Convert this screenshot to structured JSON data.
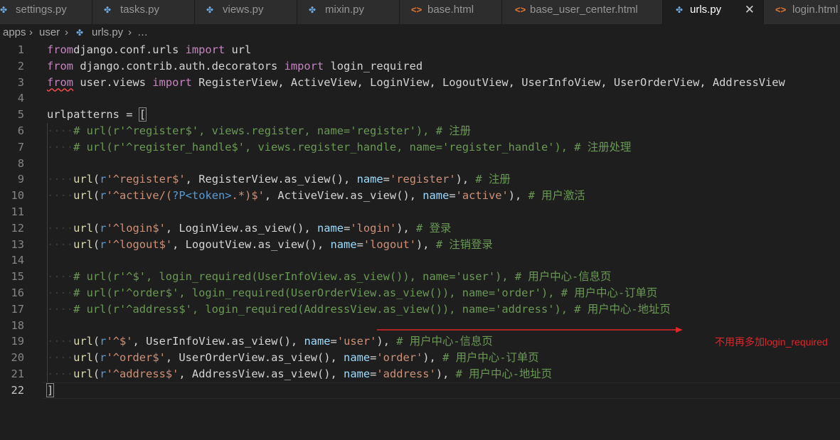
{
  "tabs": [
    {
      "label": "settings.py",
      "icon": "python-icon",
      "active": false
    },
    {
      "label": "tasks.py",
      "icon": "python-icon",
      "active": false
    },
    {
      "label": "views.py",
      "icon": "python-icon",
      "active": false
    },
    {
      "label": "mixin.py",
      "icon": "python-icon",
      "active": false
    },
    {
      "label": "base.html",
      "icon": "html-icon",
      "active": false
    },
    {
      "label": "base_user_center.html",
      "icon": "html-icon",
      "active": false
    },
    {
      "label": "urls.py",
      "icon": "python-icon",
      "active": true,
      "close": "✕"
    },
    {
      "label": "login.html",
      "icon": "html-icon",
      "active": false
    }
  ],
  "breadcrumb": {
    "part1": "apps",
    "part2": "user",
    "file": "urls.py",
    "more": "…",
    "separator": "›"
  },
  "editor": {
    "current_line": 22,
    "lines": [
      {
        "n": "1",
        "t": [
          [
            "kw",
            "from"
          ],
          [
            "",
            "django.conf.urls "
          ],
          [
            "kw",
            "import"
          ],
          [
            "",
            " url"
          ]
        ]
      },
      {
        "n": "2",
        "t": [
          [
            "kw",
            "from"
          ],
          [
            "",
            " django.contrib.auth.decorators "
          ],
          [
            "kw",
            "import"
          ],
          [
            "",
            " login_required"
          ]
        ]
      },
      {
        "n": "3",
        "t": [
          [
            "kw wavy",
            "from"
          ],
          [
            "",
            " user.views "
          ],
          [
            "kw",
            "import"
          ],
          [
            "",
            " RegisterView, ActiveView, LoginView, LogoutView, UserInfoView, UserOrderView, AddressView"
          ]
        ]
      },
      {
        "n": "4",
        "t": []
      },
      {
        "n": "5",
        "t": [
          [
            "",
            "urlpatterns = "
          ],
          [
            "brk",
            "["
          ]
        ]
      },
      {
        "n": "6",
        "t": [
          [
            "ws",
            "····"
          ],
          [
            "cm",
            "# url(r'^register$', views.register, name='register'), # 注册"
          ]
        ]
      },
      {
        "n": "7",
        "t": [
          [
            "ws",
            "····"
          ],
          [
            "cm",
            "# url(r'^register_handle$', views.register_handle, name='register_handle'), # 注册处理"
          ]
        ]
      },
      {
        "n": "8",
        "t": []
      },
      {
        "n": "9",
        "t": [
          [
            "ws",
            "····"
          ],
          [
            "fn",
            "url"
          ],
          [
            "",
            "("
          ],
          [
            "rx",
            "r"
          ],
          [
            "str",
            "'^register$'"
          ],
          [
            "",
            ", RegisterView.as_view(), "
          ],
          [
            "prm",
            "name"
          ],
          [
            "",
            "="
          ],
          [
            "str",
            "'register'"
          ],
          [
            "",
            "), "
          ],
          [
            "cm",
            "# 注册"
          ]
        ]
      },
      {
        "n": "10",
        "t": [
          [
            "ws",
            "····"
          ],
          [
            "fn",
            "url"
          ],
          [
            "",
            "("
          ],
          [
            "rx",
            "r"
          ],
          [
            "str",
            "'^active/("
          ],
          [
            "rx",
            "?P<token>"
          ],
          [
            "str",
            ".*)$'"
          ],
          [
            "",
            ", ActiveView.as_view(), "
          ],
          [
            "prm",
            "name"
          ],
          [
            "",
            "="
          ],
          [
            "str",
            "'active'"
          ],
          [
            "",
            "), "
          ],
          [
            "cm",
            "# 用户激活"
          ]
        ]
      },
      {
        "n": "11",
        "t": []
      },
      {
        "n": "12",
        "t": [
          [
            "ws",
            "····"
          ],
          [
            "fn",
            "url"
          ],
          [
            "",
            "("
          ],
          [
            "rx",
            "r"
          ],
          [
            "str",
            "'^login$'"
          ],
          [
            "",
            ", LoginView.as_view(), "
          ],
          [
            "prm",
            "name"
          ],
          [
            "",
            "="
          ],
          [
            "str",
            "'login'"
          ],
          [
            "",
            "), "
          ],
          [
            "cm",
            "# 登录"
          ]
        ]
      },
      {
        "n": "13",
        "t": [
          [
            "ws",
            "····"
          ],
          [
            "fn",
            "url"
          ],
          [
            "",
            "("
          ],
          [
            "rx",
            "r"
          ],
          [
            "str",
            "'^logout$'"
          ],
          [
            "",
            ", LogoutView.as_view(), "
          ],
          [
            "prm",
            "name"
          ],
          [
            "",
            "="
          ],
          [
            "str",
            "'logout'"
          ],
          [
            "",
            "), "
          ],
          [
            "cm",
            "# 注销登录"
          ]
        ]
      },
      {
        "n": "14",
        "t": []
      },
      {
        "n": "15",
        "t": [
          [
            "ws",
            "····"
          ],
          [
            "cm",
            "# url(r'^$', login_required(UserInfoView.as_view()), name='user'), # 用户中心-信息页"
          ]
        ]
      },
      {
        "n": "16",
        "t": [
          [
            "ws",
            "····"
          ],
          [
            "cm",
            "# url(r'^order$', login_required(UserOrderView.as_view()), name='order'), # 用户中心-订单页"
          ]
        ]
      },
      {
        "n": "17",
        "t": [
          [
            "ws",
            "····"
          ],
          [
            "cm",
            "# url(r'^address$', login_required(AddressView.as_view()), name='address'), # 用户中心-地址页"
          ]
        ]
      },
      {
        "n": "18",
        "t": []
      },
      {
        "n": "19",
        "t": [
          [
            "ws",
            "····"
          ],
          [
            "fn",
            "url"
          ],
          [
            "",
            "("
          ],
          [
            "rx",
            "r"
          ],
          [
            "str",
            "'^$'"
          ],
          [
            "",
            ", UserInfoView.as_view(), "
          ],
          [
            "prm",
            "name"
          ],
          [
            "",
            "="
          ],
          [
            "str",
            "'user'"
          ],
          [
            "",
            "), "
          ],
          [
            "cm",
            "# 用户中心-信息页"
          ]
        ]
      },
      {
        "n": "20",
        "t": [
          [
            "ws",
            "····"
          ],
          [
            "fn",
            "url"
          ],
          [
            "",
            "("
          ],
          [
            "rx",
            "r"
          ],
          [
            "str",
            "'^order$'"
          ],
          [
            "",
            ", UserOrderView.as_view(), "
          ],
          [
            "prm",
            "name"
          ],
          [
            "",
            "="
          ],
          [
            "str",
            "'order'"
          ],
          [
            "",
            "), "
          ],
          [
            "cm",
            "# 用户中心-订单页"
          ]
        ]
      },
      {
        "n": "21",
        "t": [
          [
            "ws",
            "····"
          ],
          [
            "fn",
            "url"
          ],
          [
            "",
            "("
          ],
          [
            "rx",
            "r"
          ],
          [
            "str",
            "'^address$'"
          ],
          [
            "",
            ", AddressView.as_view(), "
          ],
          [
            "prm",
            "name"
          ],
          [
            "",
            "="
          ],
          [
            "str",
            "'address'"
          ],
          [
            "",
            "), "
          ],
          [
            "cm",
            "# 用户中心-地址页"
          ]
        ]
      },
      {
        "n": "22",
        "t": [
          [
            "brk",
            "]"
          ]
        ]
      }
    ]
  },
  "annotation": {
    "text": "不用再多加login_required",
    "color": "#e0262b"
  }
}
